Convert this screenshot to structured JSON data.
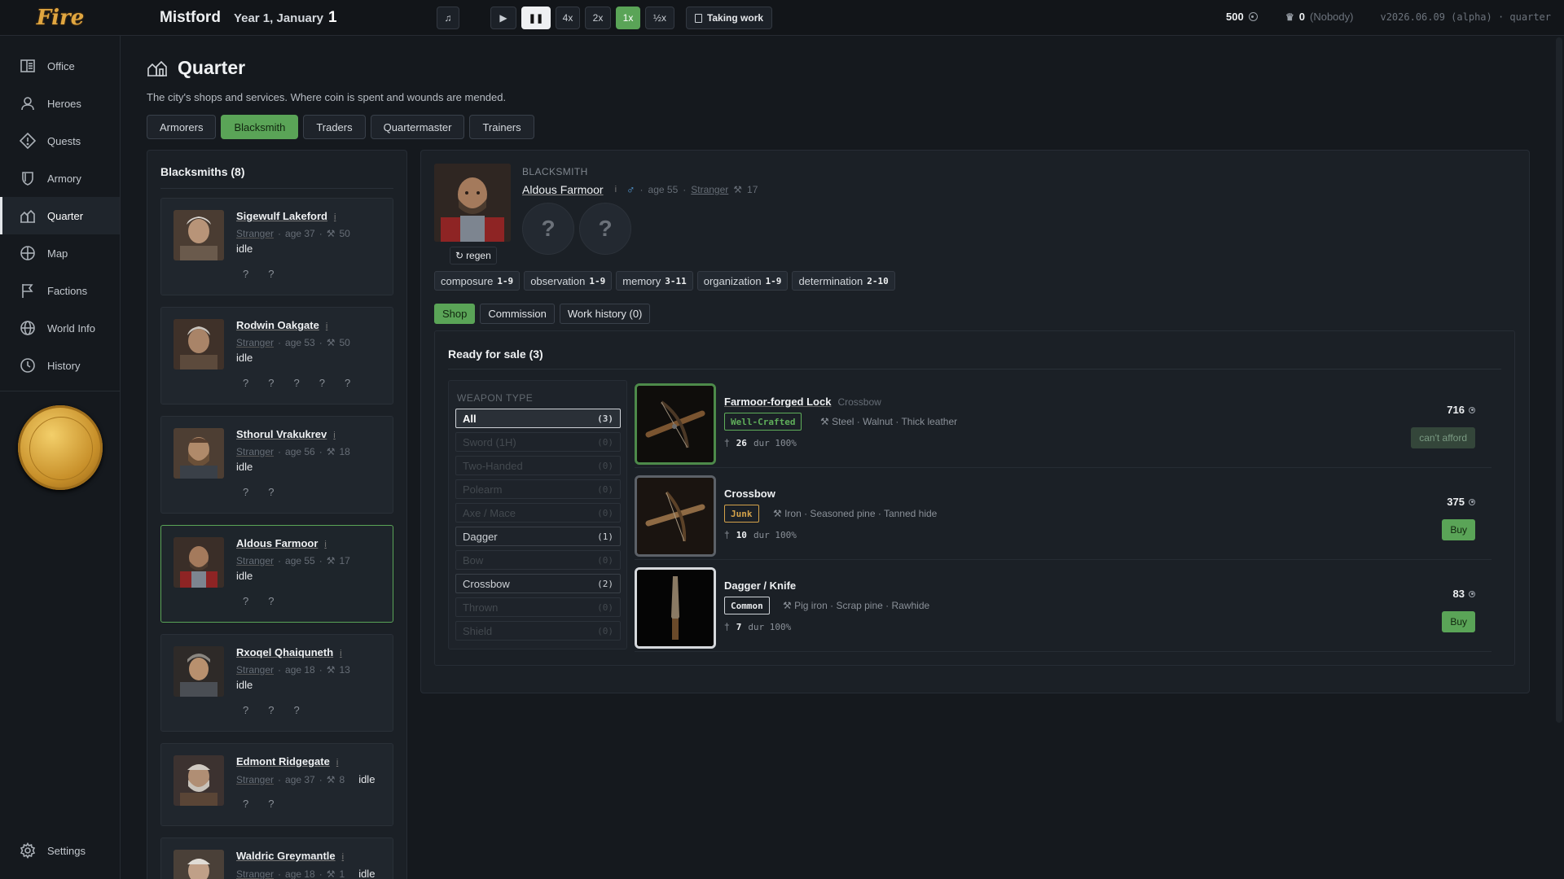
{
  "app": {
    "logo": "Fire",
    "town": "Mistford",
    "date_text": "Year 1, January",
    "day": "1",
    "version": "v2026.06.09 (alpha) · quarter"
  },
  "controls": {
    "music_icon": "music-note-icon",
    "speeds": [
      "4x",
      "2x",
      "1x",
      "½x"
    ],
    "active_speed": "1x",
    "work_status": "Taking work"
  },
  "resources": {
    "coins": "500",
    "renown": "0",
    "renown_holder": "(Nobody)"
  },
  "sidebar": {
    "items": [
      {
        "label": "Office",
        "icon": "office-icon"
      },
      {
        "label": "Heroes",
        "icon": "person-icon"
      },
      {
        "label": "Quests",
        "icon": "diamond-icon"
      },
      {
        "label": "Armory",
        "icon": "shield-icon"
      },
      {
        "label": "Quarter",
        "icon": "house-icon"
      },
      {
        "label": "Map",
        "icon": "globe-icon"
      },
      {
        "label": "Factions",
        "icon": "flag-icon"
      },
      {
        "label": "World Info",
        "icon": "world-icon"
      },
      {
        "label": "History",
        "icon": "clock-icon"
      }
    ],
    "active": "Quarter",
    "settings_label": "Settings"
  },
  "page": {
    "title": "Quarter",
    "subtitle": "The city's shops and services. Where coin is spent and wounds are mended.",
    "tabs": [
      "Armorers",
      "Blacksmith",
      "Traders",
      "Quartermaster",
      "Trainers"
    ],
    "active_tab": "Blacksmith"
  },
  "blacksmiths": {
    "heading": "Blacksmiths (8)",
    "list": [
      {
        "name": "Sigewulf Lakeford",
        "origin": "Stranger",
        "age": "age 37",
        "skill": "50",
        "status": "idle",
        "unknowns": [
          "?",
          "?"
        ]
      },
      {
        "name": "Rodwin Oakgate",
        "origin": "Stranger",
        "age": "age 53",
        "skill": "50",
        "status": "idle",
        "unknowns": [
          "?",
          "?",
          "?",
          "?",
          "?"
        ]
      },
      {
        "name": "Sthorul Vrakukrev",
        "origin": "Stranger",
        "age": "age 56",
        "skill": "18",
        "status": "idle",
        "unknowns": [
          "?",
          "?"
        ]
      },
      {
        "name": "Aldous Farmoor",
        "origin": "Stranger",
        "age": "age 55",
        "skill": "17",
        "status": "idle",
        "unknowns": [
          "?",
          "?"
        ]
      },
      {
        "name": "Rxoqel Qhaiquneth",
        "origin": "Stranger",
        "age": "age 18",
        "skill": "13",
        "status": "idle",
        "unknowns": [
          "?",
          "?",
          "?"
        ]
      },
      {
        "name": "Edmont Ridgegate",
        "origin": "Stranger",
        "age": "age 37",
        "skill": "8",
        "status": "idle",
        "unknowns": [
          "?",
          "?"
        ]
      },
      {
        "name": "Waldric Greymantle",
        "origin": "Stranger",
        "age": "age 18",
        "skill": "1",
        "status": "idle",
        "unknowns": []
      }
    ],
    "selected": "Aldous Farmoor"
  },
  "detail": {
    "role": "BLACKSMITH",
    "name": "Aldous Farmoor",
    "age": "age 55",
    "origin": "Stranger",
    "skill": "17",
    "regen_label": "regen",
    "unknown_traits": [
      "?",
      "?"
    ],
    "stats": [
      {
        "name": "composure",
        "range": "1-9"
      },
      {
        "name": "observation",
        "range": "1-9"
      },
      {
        "name": "memory",
        "range": "3-11"
      },
      {
        "name": "organization",
        "range": "1-9"
      },
      {
        "name": "determination",
        "range": "2-10"
      }
    ],
    "subtabs": [
      "Shop",
      "Commission",
      "Work history (0)"
    ],
    "active_subtab": "Shop"
  },
  "shop": {
    "heading": "Ready for sale (3)",
    "filter_title": "WEAPON TYPE",
    "filters": [
      {
        "label": "All",
        "count": "(3)"
      },
      {
        "label": "Sword (1H)",
        "count": "(0)"
      },
      {
        "label": "Two-Handed",
        "count": "(0)"
      },
      {
        "label": "Polearm",
        "count": "(0)"
      },
      {
        "label": "Axe / Mace",
        "count": "(0)"
      },
      {
        "label": "Dagger",
        "count": "(1)"
      },
      {
        "label": "Bow",
        "count": "(0)"
      },
      {
        "label": "Crossbow",
        "count": "(2)"
      },
      {
        "label": "Thrown",
        "count": "(0)"
      },
      {
        "label": "Shield",
        "count": "(0)"
      }
    ],
    "active_filter": "All",
    "items": [
      {
        "name": "Farmoor-forged Lock",
        "type": "Crossbow",
        "quality": "Well-Crafted",
        "quality_color": "#5fae5a",
        "materials": "Steel · Walnut · Thick leather",
        "damage": "26",
        "durability": "dur 100%",
        "price": "716",
        "action": "can't afford"
      },
      {
        "name": "Crossbow",
        "type": "",
        "quality": "Junk",
        "quality_color": "#d4a24a",
        "materials": "Iron · Seasoned pine · Tanned hide",
        "damage": "10",
        "durability": "dur 100%",
        "price": "375",
        "action": "Buy"
      },
      {
        "name": "Dagger / Knife",
        "type": "",
        "quality": "Common",
        "quality_color": "#e6e8eb",
        "materials": "Pig iron · Scrap pine · Rawhide",
        "damage": "7",
        "durability": "dur 100%",
        "price": "83",
        "action": "Buy"
      }
    ]
  }
}
